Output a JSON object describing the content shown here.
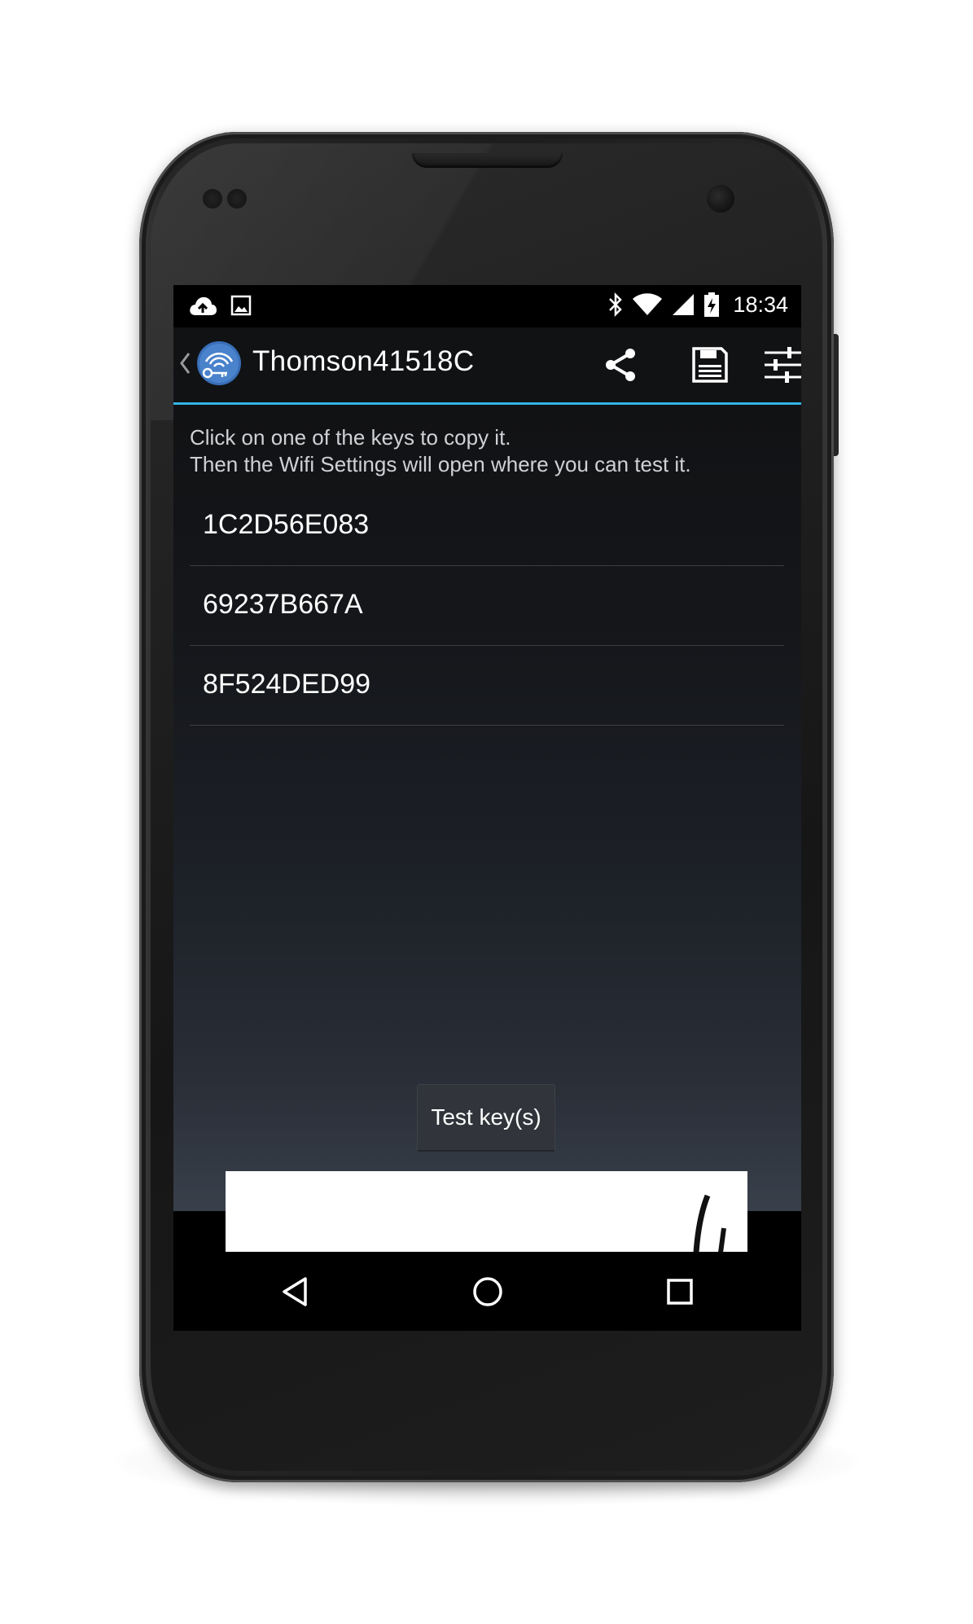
{
  "status_bar": {
    "time": "18:34",
    "icons": [
      "cloud-upload-icon",
      "image-icon",
      "bluetooth-icon",
      "wifi-icon",
      "cell-signal-icon",
      "battery-charging-icon"
    ]
  },
  "action_bar": {
    "title": "Thomson41518C",
    "actions": [
      "share-icon",
      "save-icon",
      "settings-sliders-icon"
    ],
    "accent_color": "#33b5e5"
  },
  "main": {
    "instruction_line1": "Click on one of the keys to copy it.",
    "instruction_line2": "Then the Wifi Settings will open where you can test it.",
    "keys": [
      "1C2D56E083",
      "69237B667A",
      "8F524DED99"
    ],
    "test_button_label": "Test key(s)"
  },
  "nav_bar": {
    "buttons": [
      "back-icon",
      "home-icon",
      "recents-icon"
    ]
  }
}
